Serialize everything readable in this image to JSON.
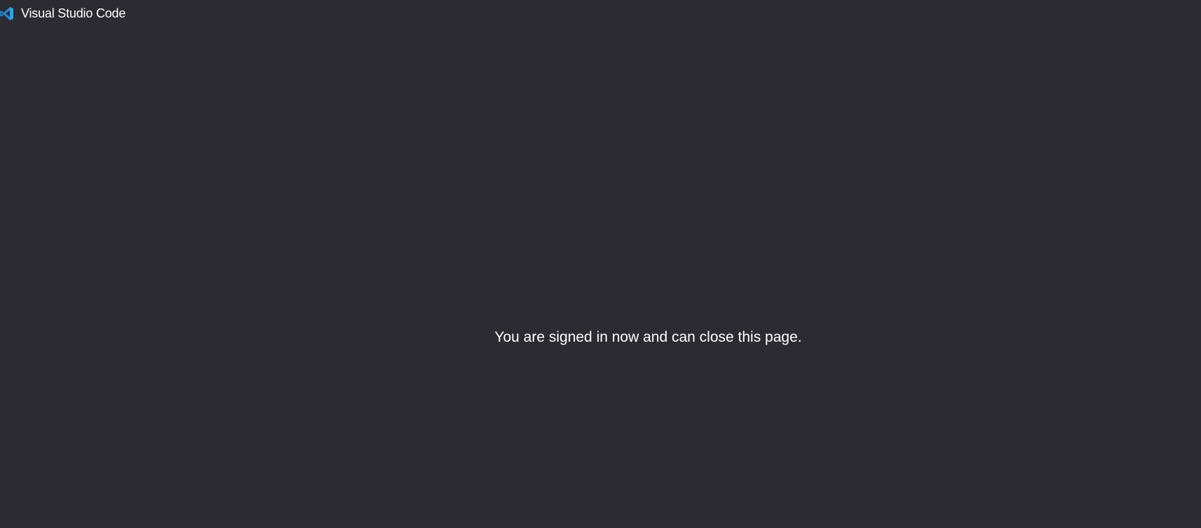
{
  "header": {
    "title": "Visual Studio Code",
    "logo_icon": "vscode-logo-icon",
    "logo_color": "#1e8bd6"
  },
  "main": {
    "message": "You are signed in now and can close this page."
  },
  "colors": {
    "background": "#2c2b32",
    "text": "#ffffff"
  }
}
